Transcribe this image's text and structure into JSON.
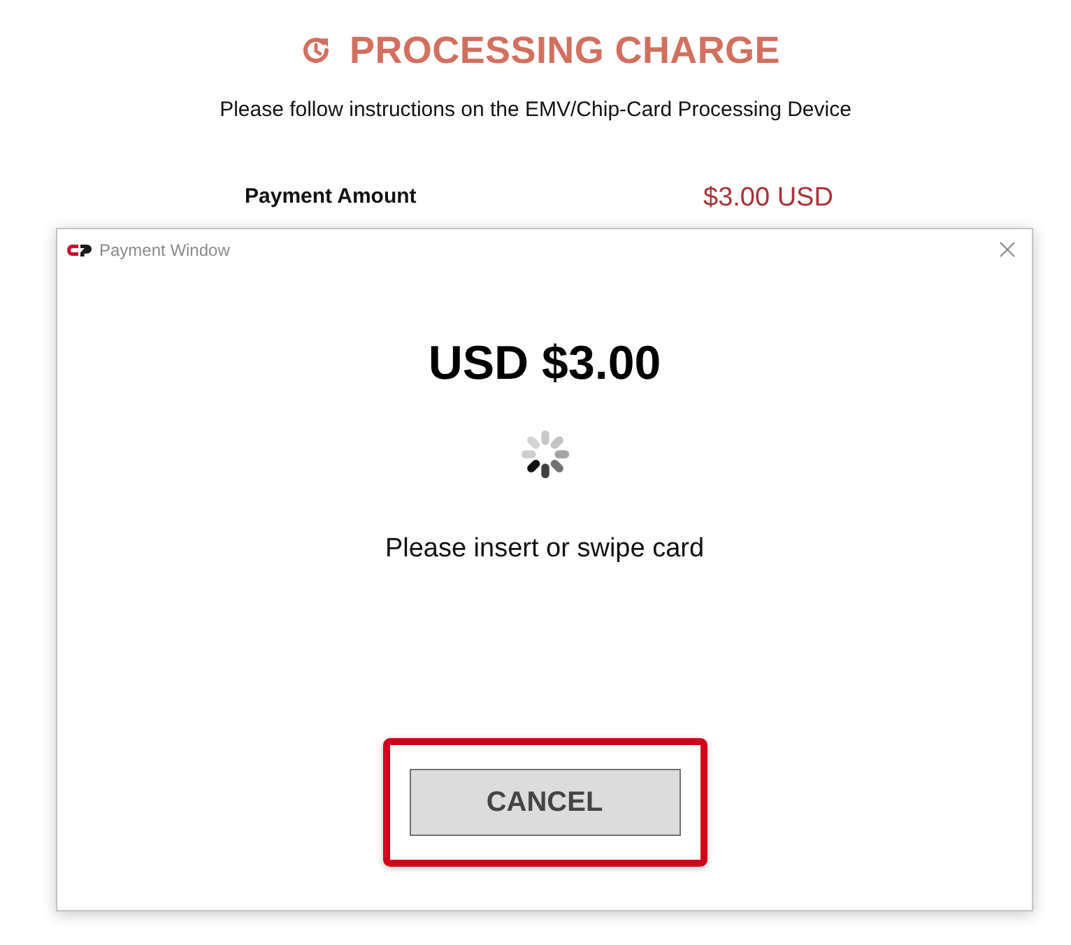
{
  "page": {
    "title": "PROCESSING CHARGE",
    "instructions": "Please follow instructions on the EMV/Chip-Card Processing Device",
    "payment": {
      "label": "Payment Amount",
      "value": "$3.00 USD"
    }
  },
  "dialog": {
    "title": "Payment Window",
    "amount": "USD $3.00",
    "message": "Please insert or swipe card",
    "buttons": [
      {
        "label": "CANCEL",
        "highlighted": true
      }
    ]
  }
}
